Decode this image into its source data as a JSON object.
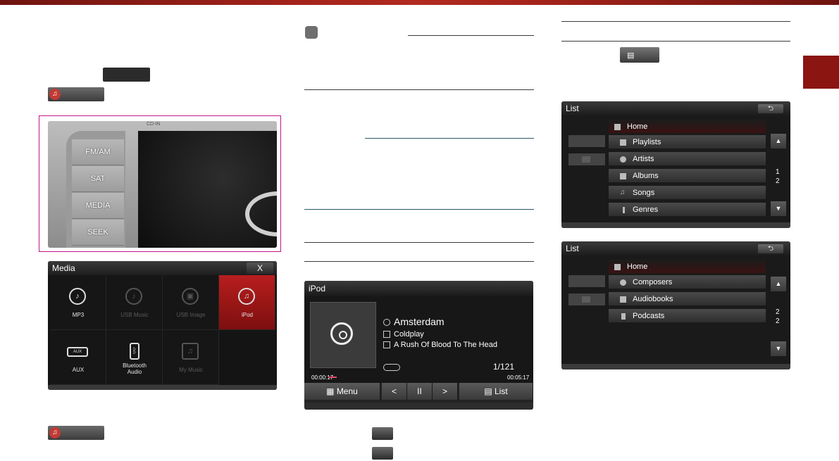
{
  "head_unit": {
    "top_label": "CD-IN",
    "buttons": [
      "FM/AM",
      "SAT",
      "MEDIA",
      "SEEK"
    ]
  },
  "media_menu": {
    "title": "Media",
    "close_label": "X",
    "tiles": [
      {
        "label": "MP3",
        "icon": "disc-music-icon",
        "enabled": true,
        "selected": false
      },
      {
        "label": "USB Music",
        "icon": "usb-music-icon",
        "enabled": false,
        "selected": false
      },
      {
        "label": "USB Image",
        "icon": "usb-image-icon",
        "enabled": false,
        "selected": false
      },
      {
        "label": "iPod",
        "icon": "ipod-icon",
        "enabled": true,
        "selected": true
      },
      {
        "label": "AUX",
        "icon": "aux-icon",
        "enabled": true,
        "selected": false
      },
      {
        "label": "Bluetooth Audio",
        "icon": "bluetooth-icon",
        "enabled": true,
        "selected": false
      },
      {
        "label": "My Music",
        "icon": "my-music-icon",
        "enabled": false,
        "selected": false
      }
    ]
  },
  "ipod_screen": {
    "title": "iPod",
    "track": "Amsterdam",
    "artist": "Coldplay",
    "album": "A Rush Of Blood To The Head",
    "counter": "1/121",
    "elapsed": "00:00:17",
    "total": "00:05:17",
    "progress_fraction": 0.05,
    "controls": {
      "menu": "Menu",
      "prev": "<",
      "play_pause": "II",
      "next": ">",
      "list": "List"
    }
  },
  "list_page1": {
    "title": "List",
    "back": "⮌",
    "home": "Home",
    "items": [
      "Playlists",
      "Artists",
      "Albums",
      "Songs",
      "Genres"
    ],
    "page": "1",
    "pages": "2"
  },
  "list_page2": {
    "title": "List",
    "back": "⮌",
    "home": "Home",
    "items": [
      "Composers",
      "Audiobooks",
      "Podcasts"
    ],
    "page": "2",
    "pages": "2"
  },
  "colors": {
    "accent": "#8b1510",
    "frame": "#c2168a",
    "selected_tile": "#b81e1e",
    "progress": "#e14b6b"
  }
}
